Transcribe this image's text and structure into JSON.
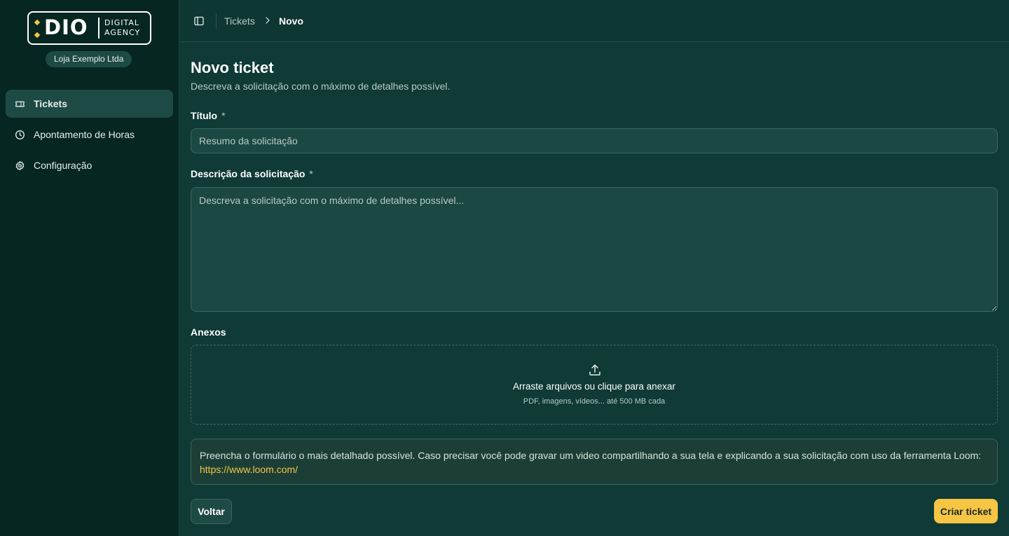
{
  "brand": {
    "logo_word": "DIO",
    "logo_sub_line1": "DIGITAL",
    "logo_sub_line2": "AGENCY",
    "company": "Loja Exemplo Ltda"
  },
  "sidebar": {
    "items": [
      {
        "label": "Tickets",
        "icon": "ticket-icon",
        "active": true
      },
      {
        "label": "Apontamento de Horas",
        "icon": "clock-icon",
        "active": false
      },
      {
        "label": "Configuração",
        "icon": "gear-icon",
        "active": false
      }
    ]
  },
  "breadcrumb": {
    "parent": "Tickets",
    "current": "Novo"
  },
  "page": {
    "title": "Novo ticket",
    "subtitle": "Descreva a solicitação com o máximo de detalhes possível."
  },
  "form": {
    "title_label": "Título",
    "required_mark": "*",
    "title_placeholder": "Resumo da solicitação",
    "title_value": "",
    "description_label": "Descrição da solicitação",
    "description_placeholder": "Descreva a solicitação com o máximo de detalhes possível...",
    "description_value": "",
    "attachments_label": "Anexos",
    "dropzone_title": "Arraste arquivos ou clique para anexar",
    "dropzone_hint": "PDF, imagens, vídeos... até 500 MB cada"
  },
  "notice": {
    "text": "Preencha o formulário o mais detalhado possível. Caso precisar você pode gravar um video compartilhando a sua tela e explicando a sua solicitação com uso da ferramenta Loom:",
    "link": "https://www.loom.com/"
  },
  "actions": {
    "back_label": "Voltar",
    "create_label": "Criar ticket"
  },
  "colors": {
    "accent": "#f6c544",
    "background": "#0f3a36",
    "sidebar": "#062622"
  }
}
